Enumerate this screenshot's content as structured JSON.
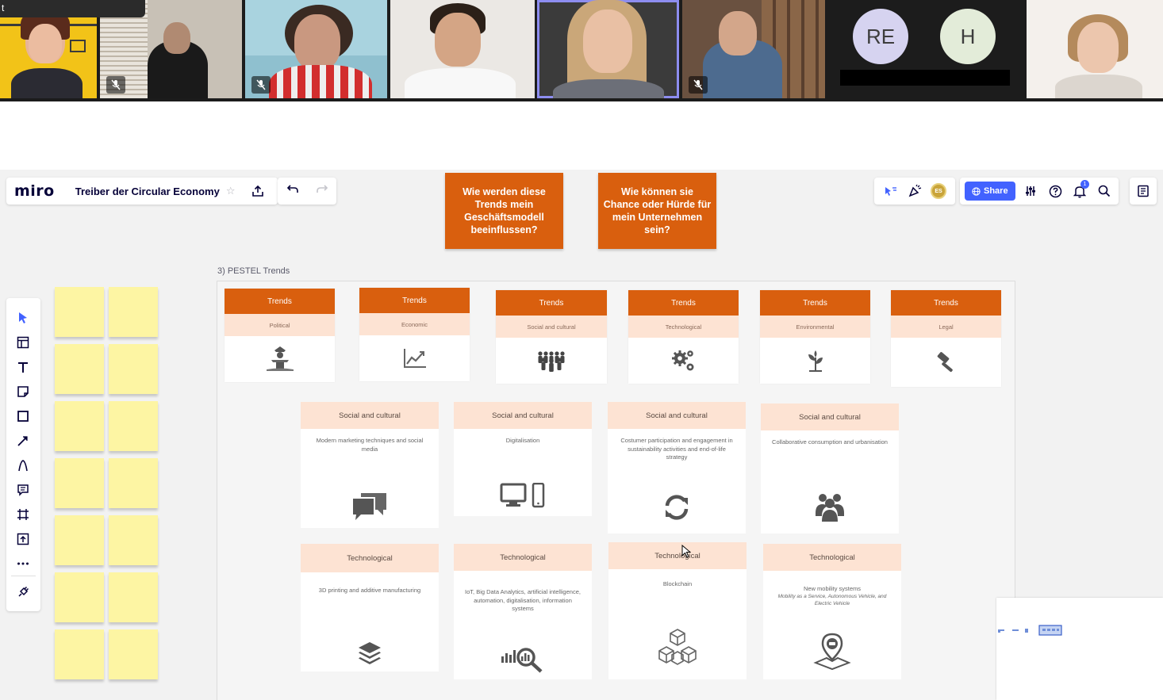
{
  "meeting": {
    "strip_tab_text": "t",
    "avatars": [
      {
        "initials": "RE",
        "color": "#d6d3f0"
      },
      {
        "initials": "H",
        "color": "#e3ecd9"
      }
    ]
  },
  "board": {
    "logo": "miro",
    "title": "Treiber der Circular Economy",
    "share_label": "Share",
    "user_initials": "ES",
    "notification_count": "1",
    "questions": [
      "Wie werden diese Trends mein Geschäftsmodell beeinflussen?",
      "Wie können sie Chance oder Hürde für mein Unternehmen sein?"
    ],
    "frame_label": "3) PESTEL Trends",
    "trend_cards": [
      {
        "title": "Trends",
        "category": "Political",
        "icon": "politician-podium-icon"
      },
      {
        "title": "Trends",
        "category": "Economic",
        "icon": "line-chart-icon"
      },
      {
        "title": "Trends",
        "category": "Social and cultural",
        "icon": "crowd-icon"
      },
      {
        "title": "Trends",
        "category": "Technological",
        "icon": "gears-icon"
      },
      {
        "title": "Trends",
        "category": "Environmental",
        "icon": "plant-icon"
      },
      {
        "title": "Trends",
        "category": "Legal",
        "icon": "gavel-icon"
      }
    ],
    "social_cards": [
      {
        "title": "Social and cultural",
        "text": "Modern marketing techniques and social media",
        "icon": "chat-bubbles-icon"
      },
      {
        "title": "Social and cultural",
        "text": "Digitalisation",
        "icon": "devices-icon"
      },
      {
        "title": "Social and cultural",
        "text": "Costumer participation and engagement in sustainability activities and end-of-life strategy",
        "icon": "refresh-icon"
      },
      {
        "title": "Social and cultural",
        "text": "Collaborative consumption and urbanisation",
        "icon": "group-icon"
      }
    ],
    "tech_cards": [
      {
        "title": "Technological",
        "text": "3D printing and additive manufacturing",
        "icon": "layers-icon"
      },
      {
        "title": "Technological",
        "text": "IoT, Big Data Analytics, artificial intelligence, automation, digitalisation, information systems",
        "icon": "analytics-search-icon"
      },
      {
        "title": "Technological",
        "text": "Blockchain",
        "icon": "blockchain-cubes-icon"
      },
      {
        "title": "Technological",
        "text": "New mobility systems",
        "subtext": "Mobility as a Service, Autonomous Vehicle, and Electric Vehicle",
        "icon": "location-car-icon"
      }
    ],
    "colors": {
      "trend_orange": "#d95f0e",
      "trend_peach": "#fde3d3",
      "sticky_yellow": "#fdf5a3",
      "share_blue": "#4262ff"
    }
  }
}
